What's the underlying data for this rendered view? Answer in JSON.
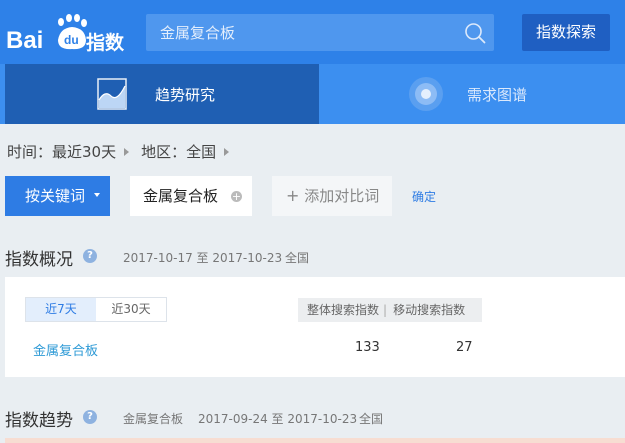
{
  "header": {
    "logo_text": "Bai du 指数",
    "search": {
      "value": "金属复合板"
    },
    "explore_button": "指数探索"
  },
  "tabs": [
    {
      "label": "趋势研究",
      "active": true,
      "icon": "trend-chart-icon"
    },
    {
      "label": "需求图谱",
      "active": false,
      "icon": "radar-circle-icon"
    }
  ],
  "filters": {
    "time": "时间：最近30天",
    "region": "地区：全国"
  },
  "keyword_bar": {
    "mode_button": "按关键词",
    "keyword": "金属复合板",
    "add_compare": "添加对比词",
    "confirm": "确定"
  },
  "overview": {
    "title": "指数概况",
    "date_range": "2017-10-17 至 2017-10-23",
    "region": "全国",
    "range_tabs": [
      {
        "label": "近7天",
        "active": true
      },
      {
        "label": "近30天",
        "active": false
      }
    ],
    "columns": [
      "整体搜索指数",
      "移动搜索指数"
    ],
    "rows": [
      {
        "keyword": "金属复合板",
        "total": "133",
        "mobile": "27"
      }
    ]
  },
  "trend": {
    "title": "指数趋势",
    "keyword": "金属复合板",
    "date_range": "2017-09-24 至 2017-10-23",
    "region": "全国"
  },
  "colors": {
    "header_bg": "#2e81e8",
    "active_tab": "#1f5fb3",
    "accent": "#2e7ce4",
    "page_bg": "#e9eef2"
  }
}
